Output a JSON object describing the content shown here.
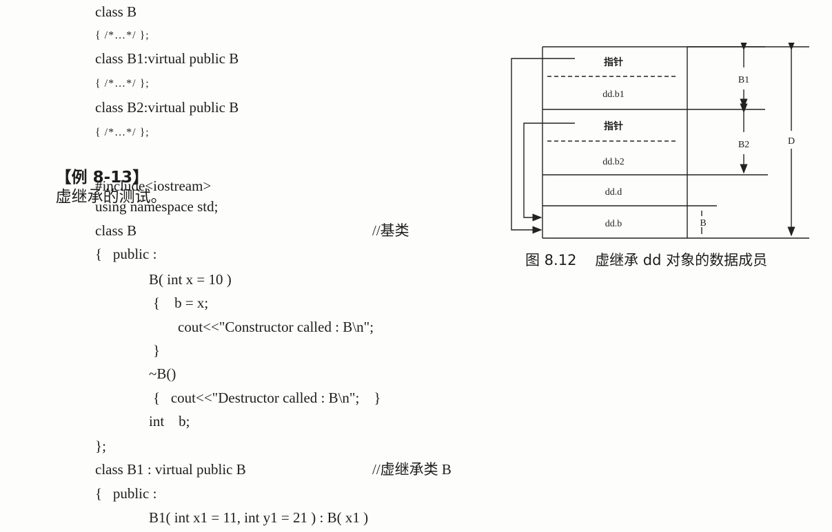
{
  "code_top": [
    "class B",
    "{ /*…*/ };",
    "class B1:virtual public B",
    "{ /*…*/ };",
    "class B2:virtual public B",
    "{ /*…*/ };"
  ],
  "example": {
    "label": "【例 8-13】",
    "title": "虚继承的测试。"
  },
  "code_main": {
    "l1": "#include<iostream>",
    "l2": "using namespace std;",
    "l3": "class B",
    "l3_comment": "//基类",
    "l4": "{   public :",
    "l5": "B( int x = 10 )",
    "l6": "{    b = x;",
    "l7": "cout<<\"Constructor called : B\\n\";",
    "l8": "}",
    "l9": "~B()",
    "l10": "{   cout<<\"Destructor called : B\\n\";    }",
    "l11": "int    b;",
    "l12": "};",
    "l13": "class B1 : virtual public B",
    "l13_comment": "//虚继承类 B",
    "l14": "{   public :",
    "l15": "B1( int x1 = 11, int y1 = 21 ) : B( x1 )"
  },
  "figure": {
    "ptr1": "指针",
    "b1_member": "dd.b1",
    "ptr2": "指针",
    "b2_member": "dd.b2",
    "d_member": "dd.d",
    "b_member": "dd.b",
    "label_b1": "B1",
    "label_b2": "B2",
    "label_d": "D",
    "label_b": "B",
    "caption": "图 8.12    虚继承 dd 对象的数据成员"
  }
}
